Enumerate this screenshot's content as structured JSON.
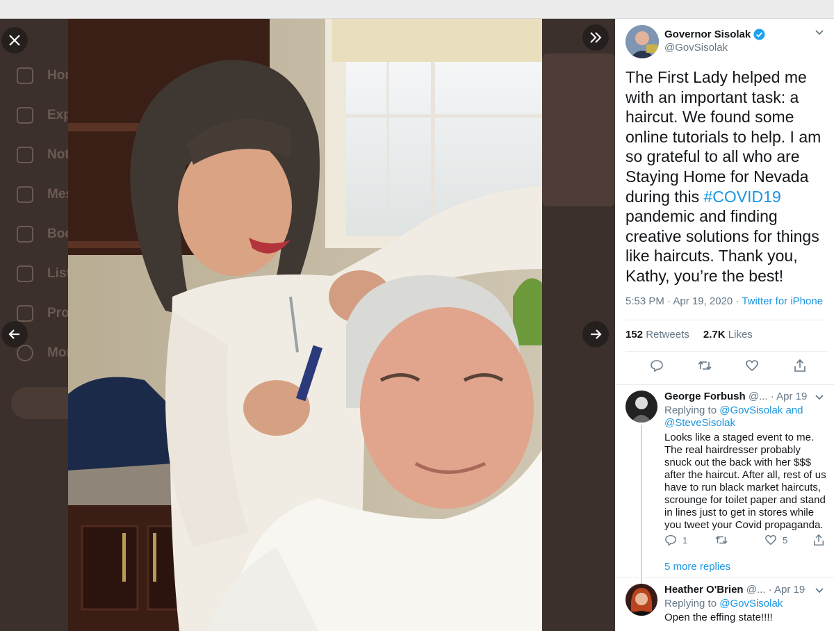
{
  "sidebar_bg": [
    "Home",
    "Explore",
    "Notifications",
    "Messages",
    "Bookmarks",
    "Lists",
    "Profile",
    "More"
  ],
  "viewer": {
    "close_icon": "close-icon",
    "expand_icon": "double-chevron-right-icon",
    "prev_icon": "arrow-left-icon",
    "next_icon": "arrow-right-icon"
  },
  "tweet": {
    "author_name": "Governor Sisolak",
    "handle": "@GovSisolak",
    "text_before": "The First Lady helped me with an important task: a haircut. We found some online tutorials to help. I am so grateful to all who are Staying Home for Nevada during this ",
    "hashtag": "#COVID19",
    "text_after": " pandemic and finding creative solutions for things like haircuts. Thank you, Kathy, you’re the best!",
    "timestamp": "5:53 PM · Apr 19, 2020 · ",
    "source": "Twitter for iPhone",
    "retweets_count": "152",
    "retweets_label": "Retweets",
    "likes_count": "2.7K",
    "likes_label": "Likes"
  },
  "replies": [
    {
      "name": "George Forbush",
      "handle_date": "@... · Apr 19",
      "replying_label": "Replying to ",
      "replying_to": "@GovSisolak and @SteveSisolak",
      "text": "Looks like a staged event to me. The real hairdresser probably snuck out the back with her $$$ after the haircut. After all, rest of us have to run black market haircuts, scrounge for toilet paper and stand in lines just to get in stores while you tweet your Covid propaganda.",
      "reply_count": "1",
      "retweet_count": "",
      "like_count": "5",
      "more_replies": "5 more replies"
    },
    {
      "name": "Heather O'Brien",
      "handle_date": "@... · Apr 19",
      "replying_label": "Replying to ",
      "replying_to": "@GovSisolak",
      "text": "Open the effing state!!!!"
    }
  ],
  "colors": {
    "link": "#1b95e0",
    "verified": "#1da1f2",
    "text": "#14171a",
    "muted": "#657786"
  }
}
